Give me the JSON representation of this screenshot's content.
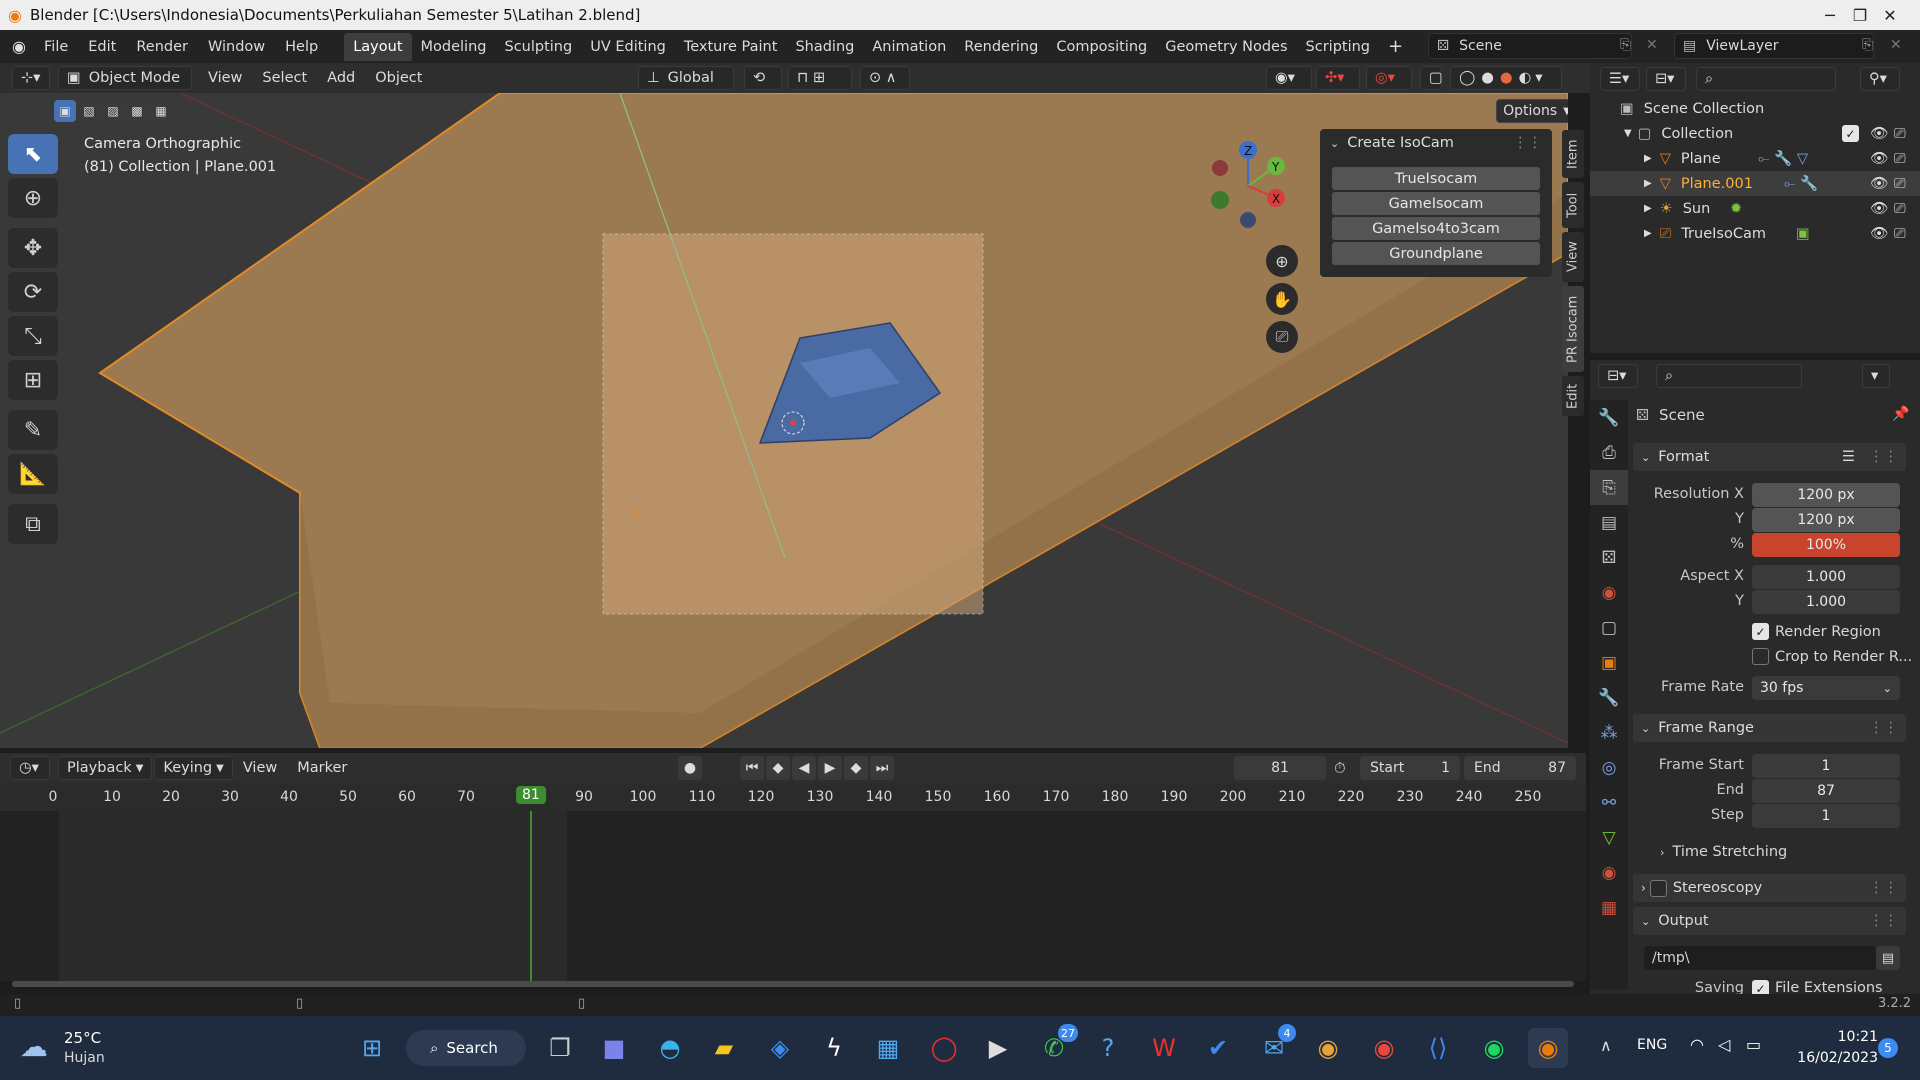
{
  "window": {
    "title": "Blender [C:\\Users\\Indonesia\\Documents\\Perkuliahan Semester 5\\Latihan 2.blend]",
    "min_glyph": "─",
    "max_glyph": "❐",
    "close_glyph": "✕"
  },
  "topbar": {
    "menus": [
      "File",
      "Edit",
      "Render",
      "Window",
      "Help"
    ],
    "workspaces": [
      "Layout",
      "Modeling",
      "Sculpting",
      "UV Editing",
      "Texture Paint",
      "Shading",
      "Animation",
      "Rendering",
      "Compositing",
      "Geometry Nodes",
      "Scripting"
    ],
    "active_workspace": "Layout",
    "scene": "Scene",
    "view_layer": "ViewLayer"
  },
  "viewport_header": {
    "mode": "Object Mode",
    "menus": [
      "View",
      "Select",
      "Add",
      "Object"
    ],
    "orientation": "Global",
    "options_label": "Options"
  },
  "viewport": {
    "camera_label": "Camera Orthographic",
    "collection_label": "(81) Collection | Plane.001",
    "axes": {
      "z": "Z",
      "y": "Y",
      "x": "X"
    }
  },
  "npanel": {
    "title": "Create IsoCam",
    "buttons": [
      "TrueIsocam",
      "GameIsocam",
      "GameIso4to3cam",
      "Groundplane"
    ],
    "tabs": [
      "Item",
      "Tool",
      "View",
      "PR Isocam",
      "Edit"
    ]
  },
  "timeline": {
    "menus": [
      "Playback",
      "Keying",
      "View",
      "Marker"
    ],
    "current_frame": "81",
    "start_label": "Start",
    "start": "1",
    "end_label": "End",
    "end": "87",
    "ticks": [
      "0",
      "10",
      "20",
      "30",
      "40",
      "50",
      "60",
      "70",
      "81",
      "90",
      "100",
      "110",
      "120",
      "130",
      "140",
      "150",
      "160",
      "170",
      "180",
      "190",
      "200",
      "210",
      "220",
      "230",
      "240",
      "250"
    ]
  },
  "outliner": {
    "root": "Scene Collection",
    "collection": "Collection",
    "items": [
      {
        "name": "Plane",
        "icon": "mesh-icon",
        "selected": false
      },
      {
        "name": "Plane.001",
        "icon": "mesh-icon",
        "selected": true
      },
      {
        "name": "Sun",
        "icon": "light-icon",
        "selected": false
      },
      {
        "name": "TrueIsoCam",
        "icon": "camera-icon",
        "selected": false
      }
    ]
  },
  "properties": {
    "context": "Scene",
    "format_section": "Format",
    "resolution_x_label": "Resolution X",
    "resolution_x": "1200 px",
    "resolution_y_label": "Y",
    "resolution_y": "1200 px",
    "percent_label": "%",
    "percent": "100%",
    "aspect_x_label": "Aspect X",
    "aspect_x": "1.000",
    "aspect_y_label": "Y",
    "aspect_y": "1.000",
    "render_region_label": "Render Region",
    "crop_label": "Crop to Render R...",
    "frame_rate_label": "Frame Rate",
    "frame_rate": "30 fps",
    "frame_range_section": "Frame Range",
    "frame_start_label": "Frame Start",
    "frame_start": "1",
    "frame_end_label": "End",
    "frame_end": "87",
    "step_label": "Step",
    "step": "1",
    "time_stretching": "Time Stretching",
    "stereoscopy": "Stereoscopy",
    "output_section": "Output",
    "output_path": "/tmp\\",
    "saving_label": "Saving",
    "file_ext_label": "File Extensions"
  },
  "statusbar": {
    "version": "3.2.2"
  },
  "taskbar": {
    "weather_temp": "25°C",
    "weather_desc": "Hujan",
    "search_label": "Search",
    "lang": "ENG",
    "time": "10:21",
    "date": "16/02/2023",
    "notif_count": "5",
    "badges": {
      "whatsapp": "27",
      "mail": "4"
    }
  },
  "colors": {
    "accent": "#4772b3",
    "orange": "#e87d0d",
    "percent_field": "#c8442c",
    "frame_marker": "#3d8c2f"
  }
}
